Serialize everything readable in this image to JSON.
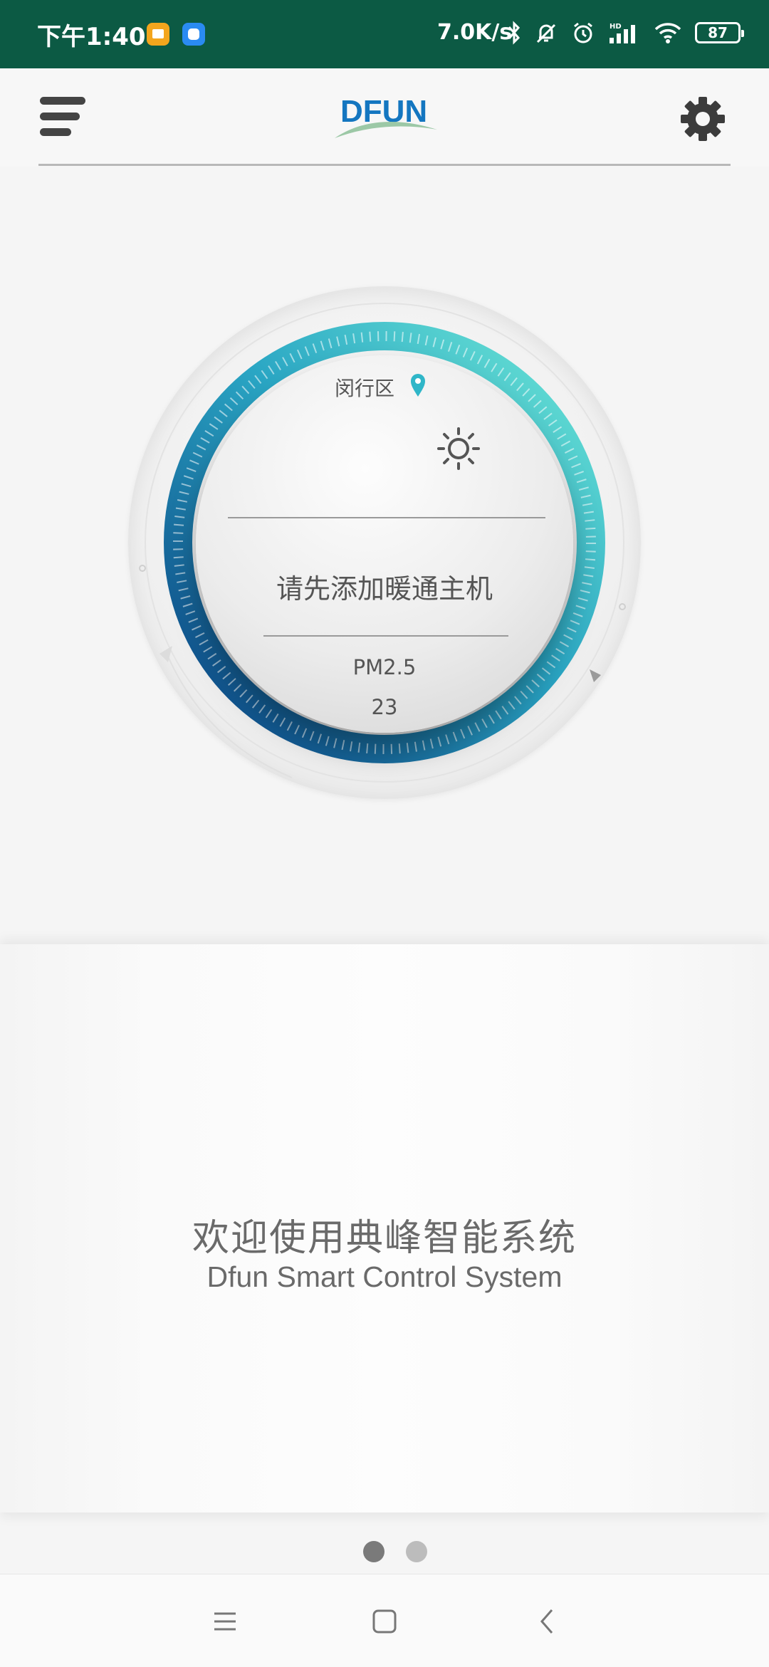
{
  "status_bar": {
    "time": "下午1:40",
    "network_speed": "7.0K/s",
    "battery": "87",
    "icons": [
      "bluetooth-icon",
      "mute-bell-icon",
      "alarm-icon",
      "hd-signal-icon",
      "wifi-icon",
      "battery-icon"
    ]
  },
  "header": {
    "logo_text": "DFUN",
    "menu_icon": "menu-icon",
    "settings_icon": "gear-icon"
  },
  "dial": {
    "location": "闵行区",
    "weather_icon": "sun-icon",
    "notice": "请先添加暖通主机",
    "pm_label": "PM2.5",
    "pm_value": "23",
    "colors": {
      "ring_start": "#6ee8d6",
      "ring_end": "#0a3f80"
    }
  },
  "welcome": {
    "title_cn": "欢迎使用典峰智能系统",
    "title_en": "Dfun Smart Control System"
  },
  "pager": {
    "pages": 2,
    "active": 1
  },
  "navbar": {
    "buttons": [
      "menu-nav-icon",
      "home-nav-icon",
      "back-nav-icon"
    ]
  }
}
